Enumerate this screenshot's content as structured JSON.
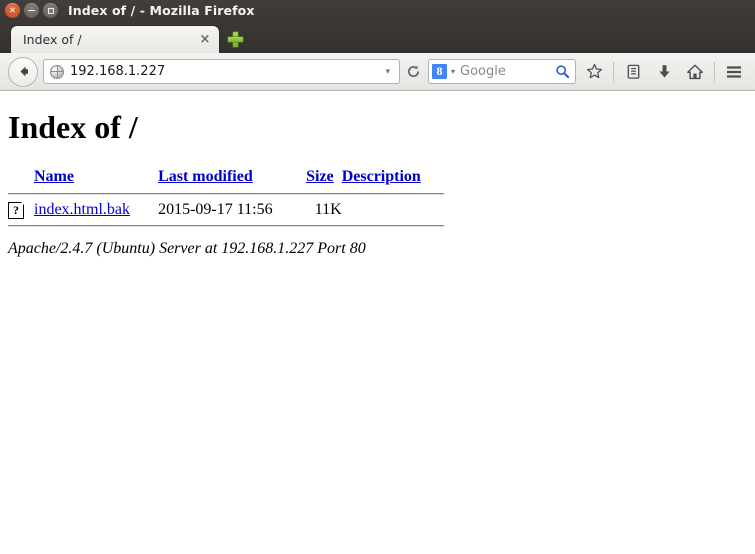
{
  "window": {
    "title": "Index of / - Mozilla Firefox",
    "controls": {
      "close": "×",
      "minimize": "−",
      "maximize": "□"
    }
  },
  "tabs": {
    "items": [
      {
        "label": "Index of /",
        "close_label": "×"
      }
    ],
    "new_tab_label": "+"
  },
  "toolbar": {
    "back_label": "←",
    "url_value": "192.168.1.227",
    "url_caret": "▾",
    "reload_label": "⟳",
    "search": {
      "engine_icon_label": "8",
      "caret": "▾",
      "placeholder": "Google"
    },
    "icons": {
      "bookmark": "☆",
      "reading_list": "🗉",
      "downloads": "↓",
      "home": "⌂",
      "menu": "☰"
    }
  },
  "page": {
    "heading": "Index of /",
    "columns": {
      "name": "Name",
      "last_modified": "Last modified",
      "size": "Size",
      "description": "Description"
    },
    "rows": [
      {
        "icon": "unknown-file-icon",
        "icon_glyph": "?",
        "name": "index.html.bak",
        "last_modified": "2015-09-17 11:56",
        "size": "11K",
        "description": ""
      }
    ],
    "footer": "Apache/2.4.7 (Ubuntu) Server at 192.168.1.227 Port 80"
  },
  "colors": {
    "link": "#0000cc",
    "titlebar": "#3b3835",
    "accent_green": "#7fb125",
    "google_blue": "#4285f4"
  }
}
